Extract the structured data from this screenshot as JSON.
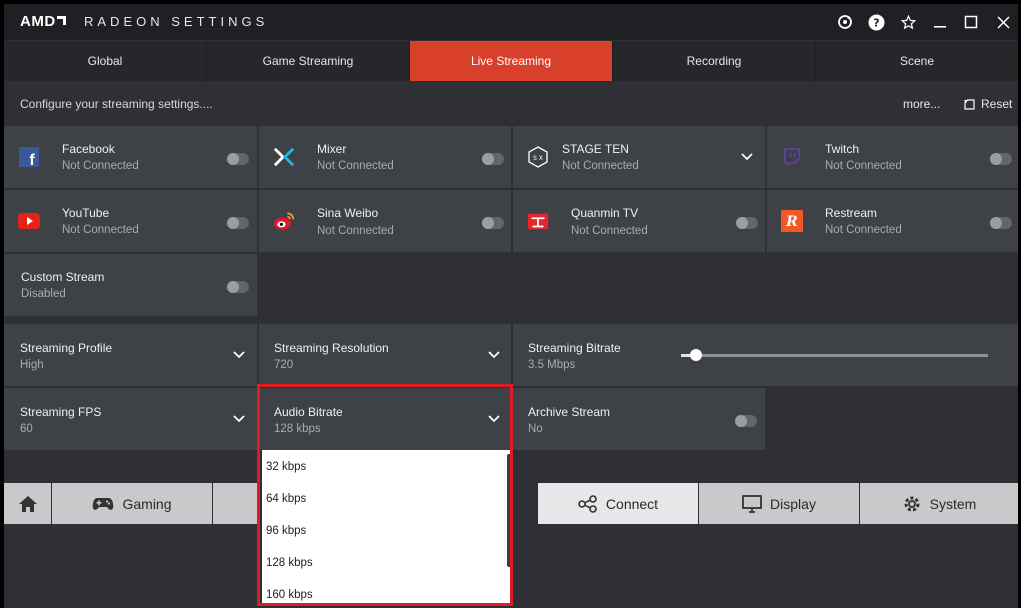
{
  "app": {
    "logo": "AMD",
    "title": "RADEON SETTINGS"
  },
  "tabs": [
    {
      "label": "Global"
    },
    {
      "label": "Game Streaming"
    },
    {
      "label": "Live Streaming"
    },
    {
      "label": "Recording"
    },
    {
      "label": "Scene"
    }
  ],
  "subheader": {
    "description": "Configure your streaming settings....",
    "more": "more...",
    "reset": "Reset"
  },
  "services": [
    {
      "name": "Facebook",
      "status": "Not Connected"
    },
    {
      "name": "Mixer",
      "status": "Not Connected"
    },
    {
      "name": "STAGE TEN",
      "status": "Not Connected"
    },
    {
      "name": "Twitch",
      "status": "Not Connected"
    },
    {
      "name": "YouTube",
      "status": "Not Connected"
    },
    {
      "name": "Sina Weibo",
      "status": "Not Connected"
    },
    {
      "name": "Quanmin TV",
      "status": "Not Connected"
    },
    {
      "name": "Restream",
      "status": "Not Connected"
    },
    {
      "name": "Custom Stream",
      "status": "Disabled"
    }
  ],
  "settings": {
    "profile": {
      "label": "Streaming Profile",
      "value": "High"
    },
    "resolution": {
      "label": "Streaming Resolution",
      "value": "720"
    },
    "bitrate": {
      "label": "Streaming Bitrate",
      "value": "3.5 Mbps",
      "level": 0.05
    },
    "fps": {
      "label": "Streaming FPS",
      "value": "60"
    },
    "audio": {
      "label": "Audio Bitrate",
      "value": "128 kbps"
    },
    "archive": {
      "label": "Archive Stream",
      "value": "No"
    }
  },
  "audio_options": [
    "32 kbps",
    "64 kbps",
    "96 kbps",
    "128 kbps",
    "160 kbps"
  ],
  "bottom_nav": {
    "gaming": "Gaming",
    "connect": "Connect",
    "display": "Display",
    "system": "System"
  },
  "colors": {
    "accent": "#d9402b",
    "highlight": "#e01b22"
  }
}
